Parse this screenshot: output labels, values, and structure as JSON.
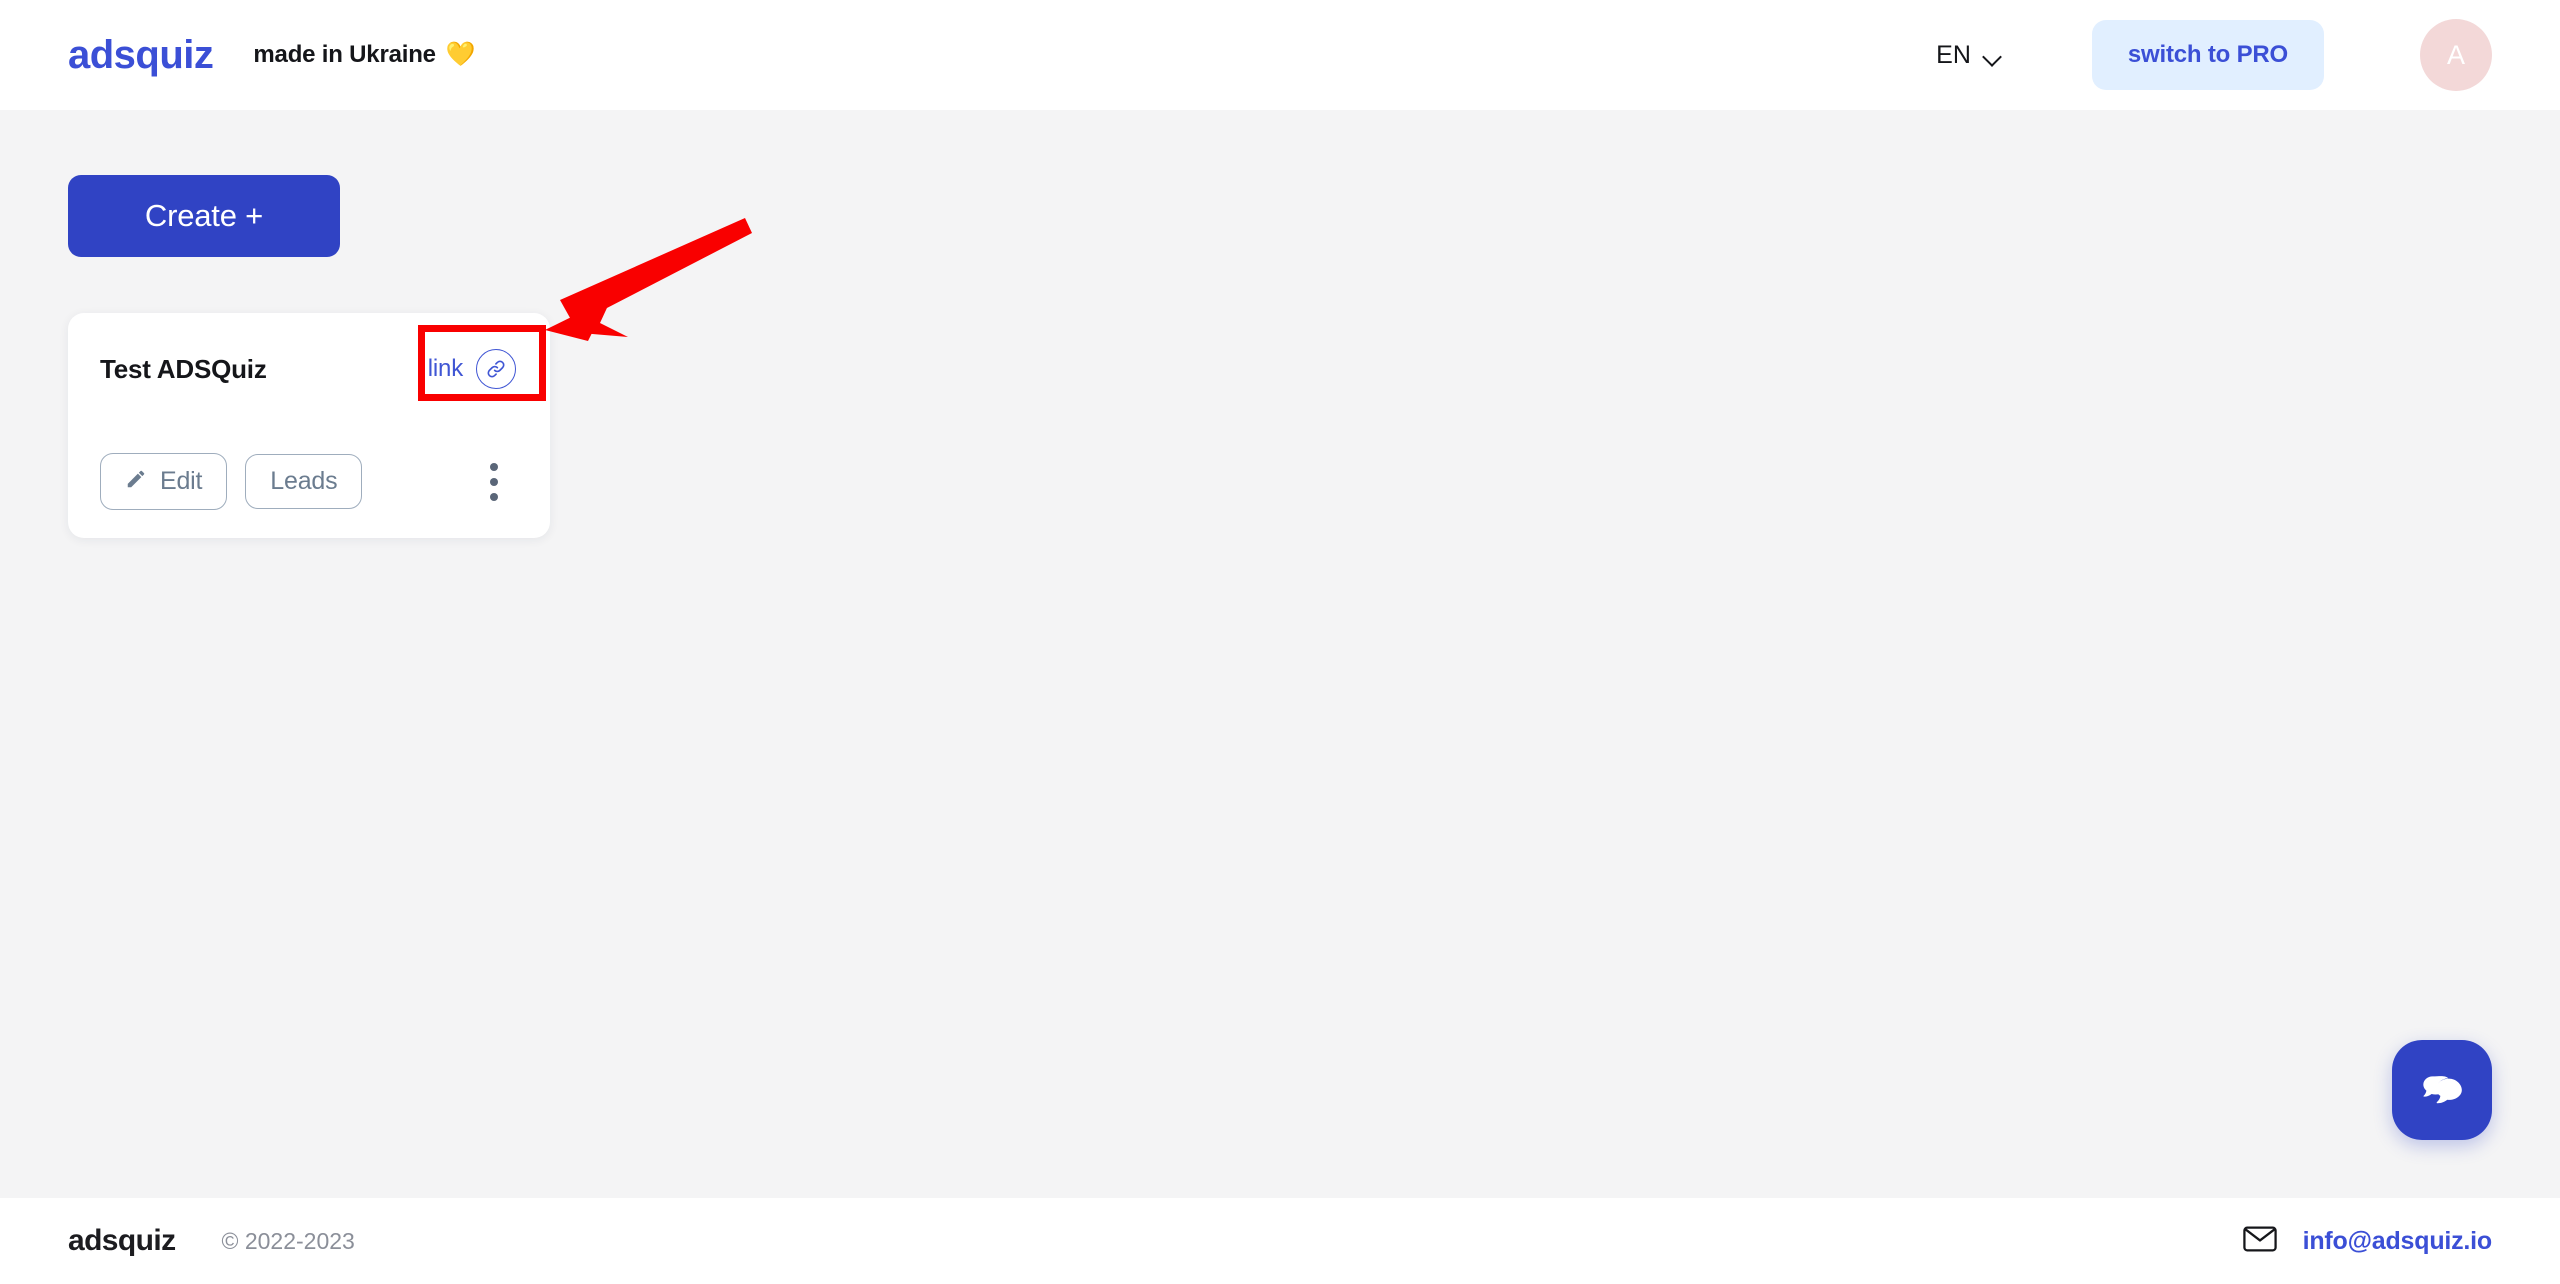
{
  "header": {
    "logo": "adsquiz",
    "tagline": "made in Ukraine",
    "tagline_emoji": "💛",
    "language": {
      "selected": "EN",
      "icon": "chevron-down-icon"
    },
    "pro_button_label": "switch to PRO",
    "avatar": {
      "initial": "A",
      "bg_color": "#f3d8d8"
    },
    "accent_color": "#3b4fd6",
    "pro_bg_color": "#e1efff"
  },
  "main": {
    "create_button_label": "Create +",
    "create_button_color": "#3043c4",
    "quizzes": [
      {
        "title": "Test ADSQuiz",
        "link_label": "link",
        "link_icon": "chain-link-icon",
        "actions": [
          {
            "label": "Edit",
            "icon": "pencil-icon"
          },
          {
            "label": "Leads",
            "icon": ""
          }
        ],
        "menu_icon": "kebab-vertical-icon"
      }
    ]
  },
  "annotation": {
    "highlight_color": "#f90000",
    "target": "link",
    "shape": "rectangle-with-arrow"
  },
  "footer": {
    "logo": "adsquiz",
    "copyright": "© 2022-2023",
    "email": "info@adsquiz.io",
    "email_icon": "envelope-icon"
  },
  "chat_widget": {
    "icon": "chat-bubbles-icon",
    "bg_color": "#3043c4"
  }
}
